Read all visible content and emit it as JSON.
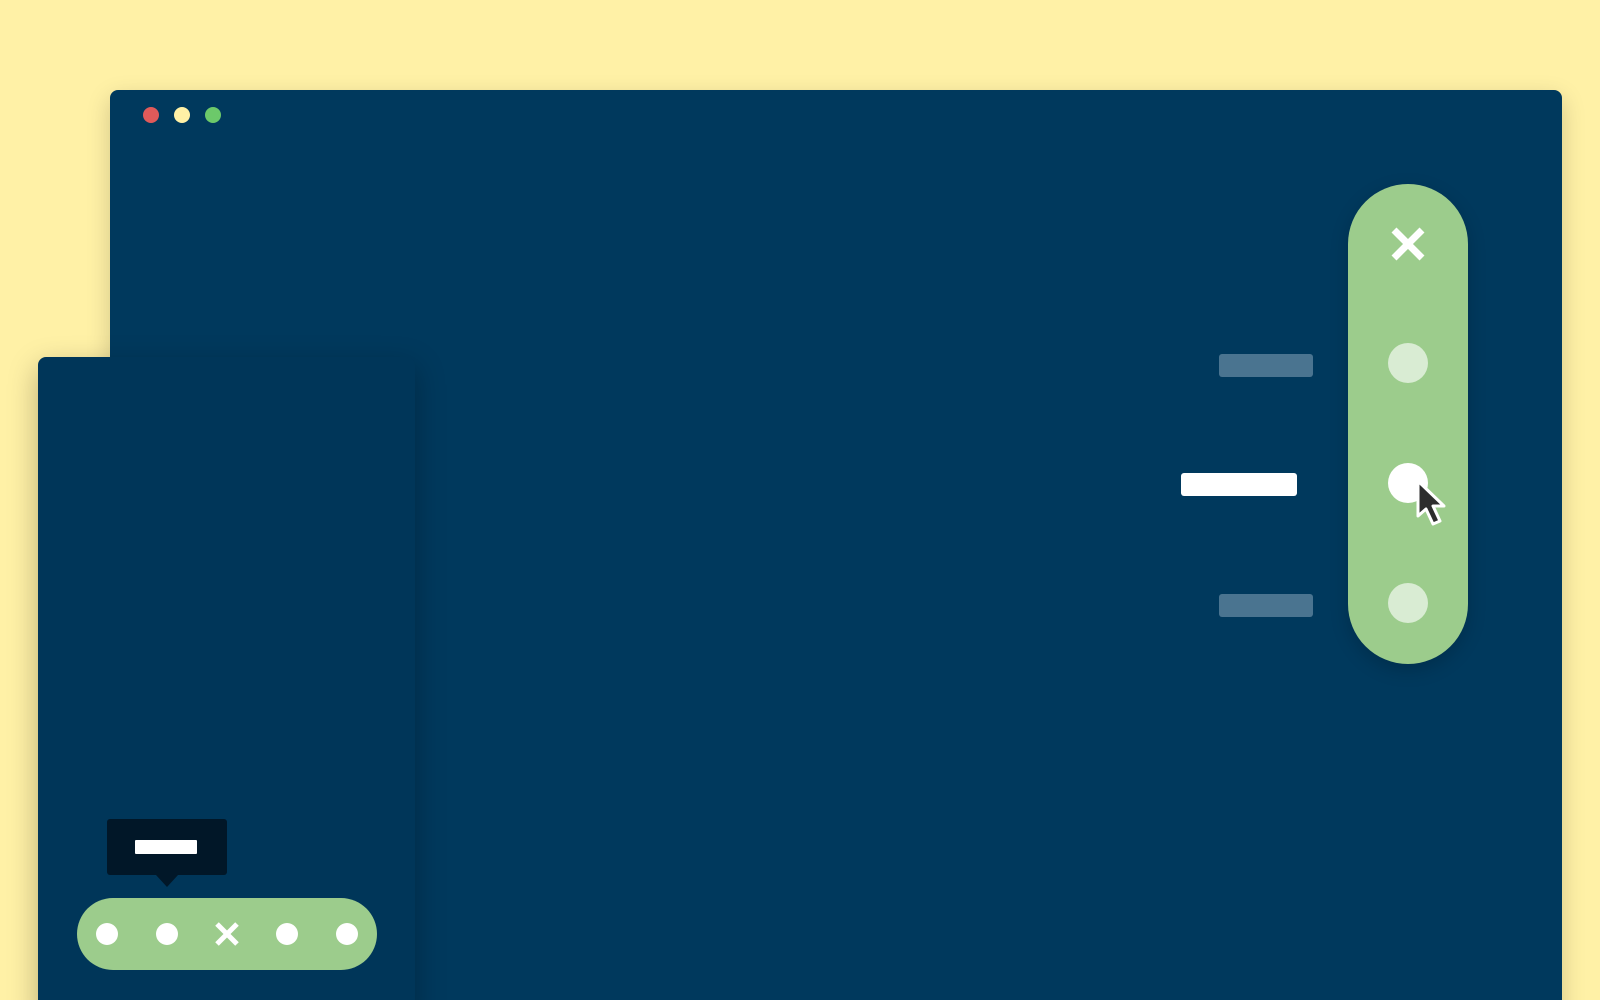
{
  "window": {
    "traffic_lights": [
      {
        "name": "close",
        "color": "#e05a5a"
      },
      {
        "name": "minimize",
        "color": "#fff1a6"
      },
      {
        "name": "maximize",
        "color": "#6cc96a"
      }
    ]
  },
  "vertical_toolbar": {
    "close_icon": "close-icon",
    "items": [
      {
        "icon": "dot-icon",
        "state": "inactive"
      },
      {
        "icon": "dot-icon",
        "state": "active"
      },
      {
        "icon": "dot-icon",
        "state": "inactive"
      }
    ]
  },
  "horizontal_toolbar": {
    "items": [
      "dot-icon",
      "dot-icon",
      "close-icon",
      "dot-icon",
      "dot-icon"
    ],
    "tooltip_target_index": 1
  },
  "colors": {
    "background": "#fff1a6",
    "window": "#00395d",
    "toolbar": "#9ccc8c",
    "active_marker": "#0b8e7b",
    "tooltip": "#011728"
  },
  "cursor": "pointer-cursor-icon"
}
